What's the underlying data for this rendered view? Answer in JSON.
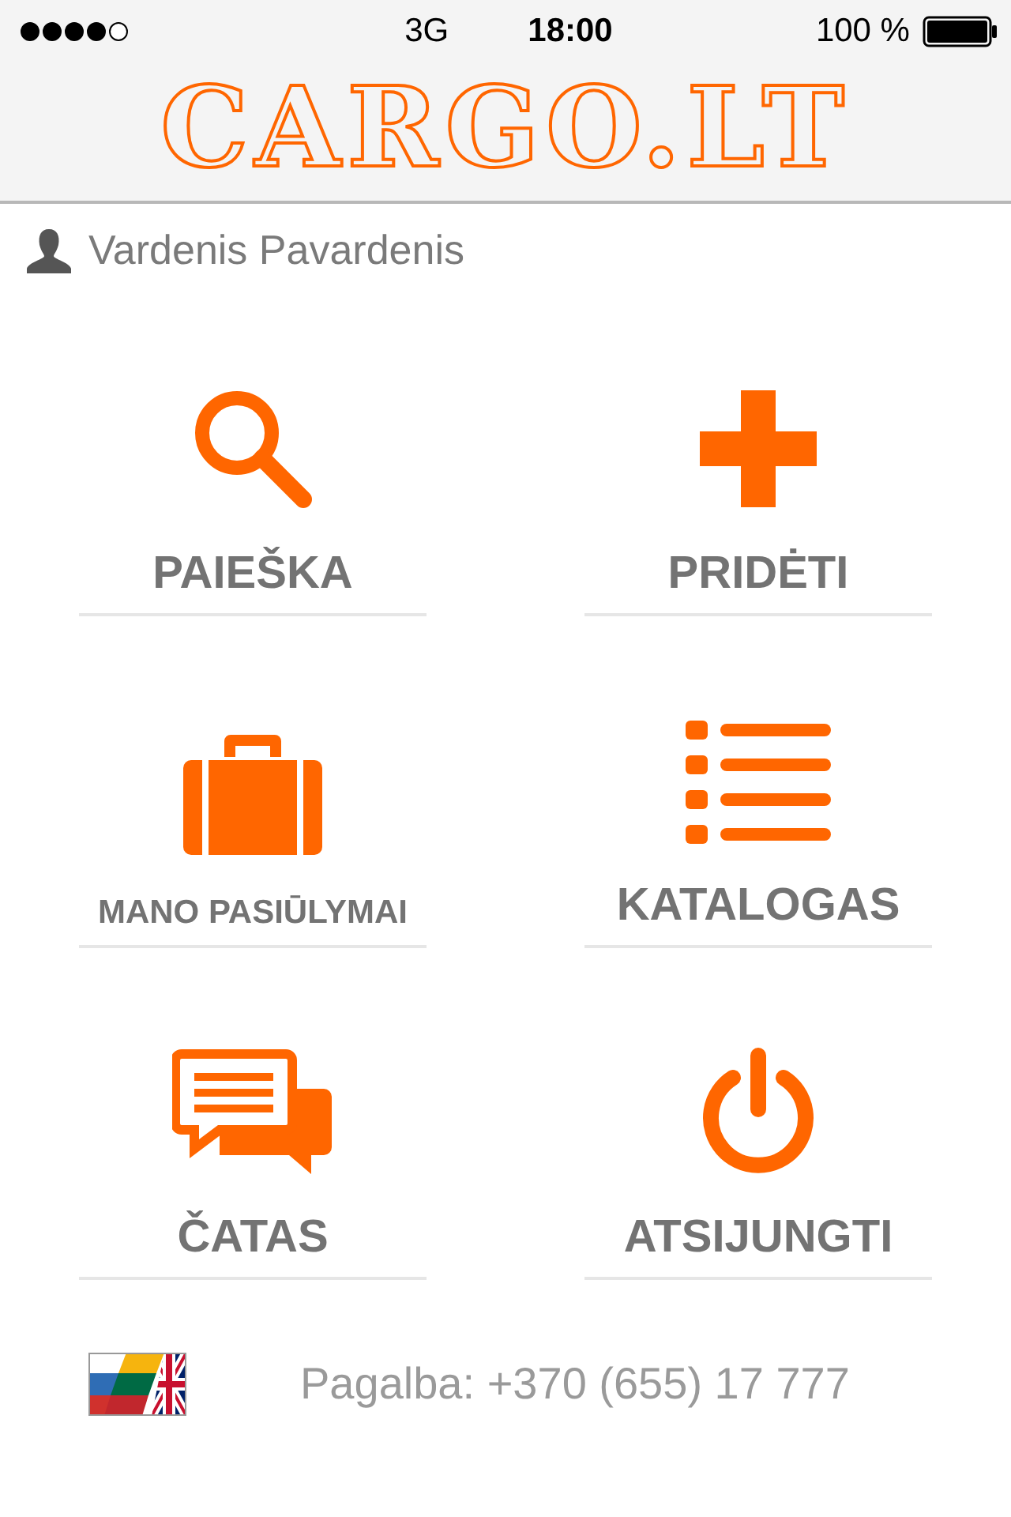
{
  "status_bar": {
    "network": "3G",
    "time": "18:00",
    "battery": "100 %"
  },
  "header": {
    "logo": "CARGO.LT"
  },
  "user": {
    "name": "Vardenis Pavardenis"
  },
  "menu": [
    {
      "label": "PAIEŠKA",
      "compact": false
    },
    {
      "label": "PRIDĖTI",
      "compact": false
    },
    {
      "label": "MANO PASIŪLYMAI",
      "compact": true
    },
    {
      "label": "KATALOGAS",
      "compact": false
    },
    {
      "label": "ČATAS",
      "compact": false
    },
    {
      "label": "ATSIJUNGTI",
      "compact": false
    }
  ],
  "footer": {
    "help": "Pagalba: +370 (655) 17 777"
  }
}
